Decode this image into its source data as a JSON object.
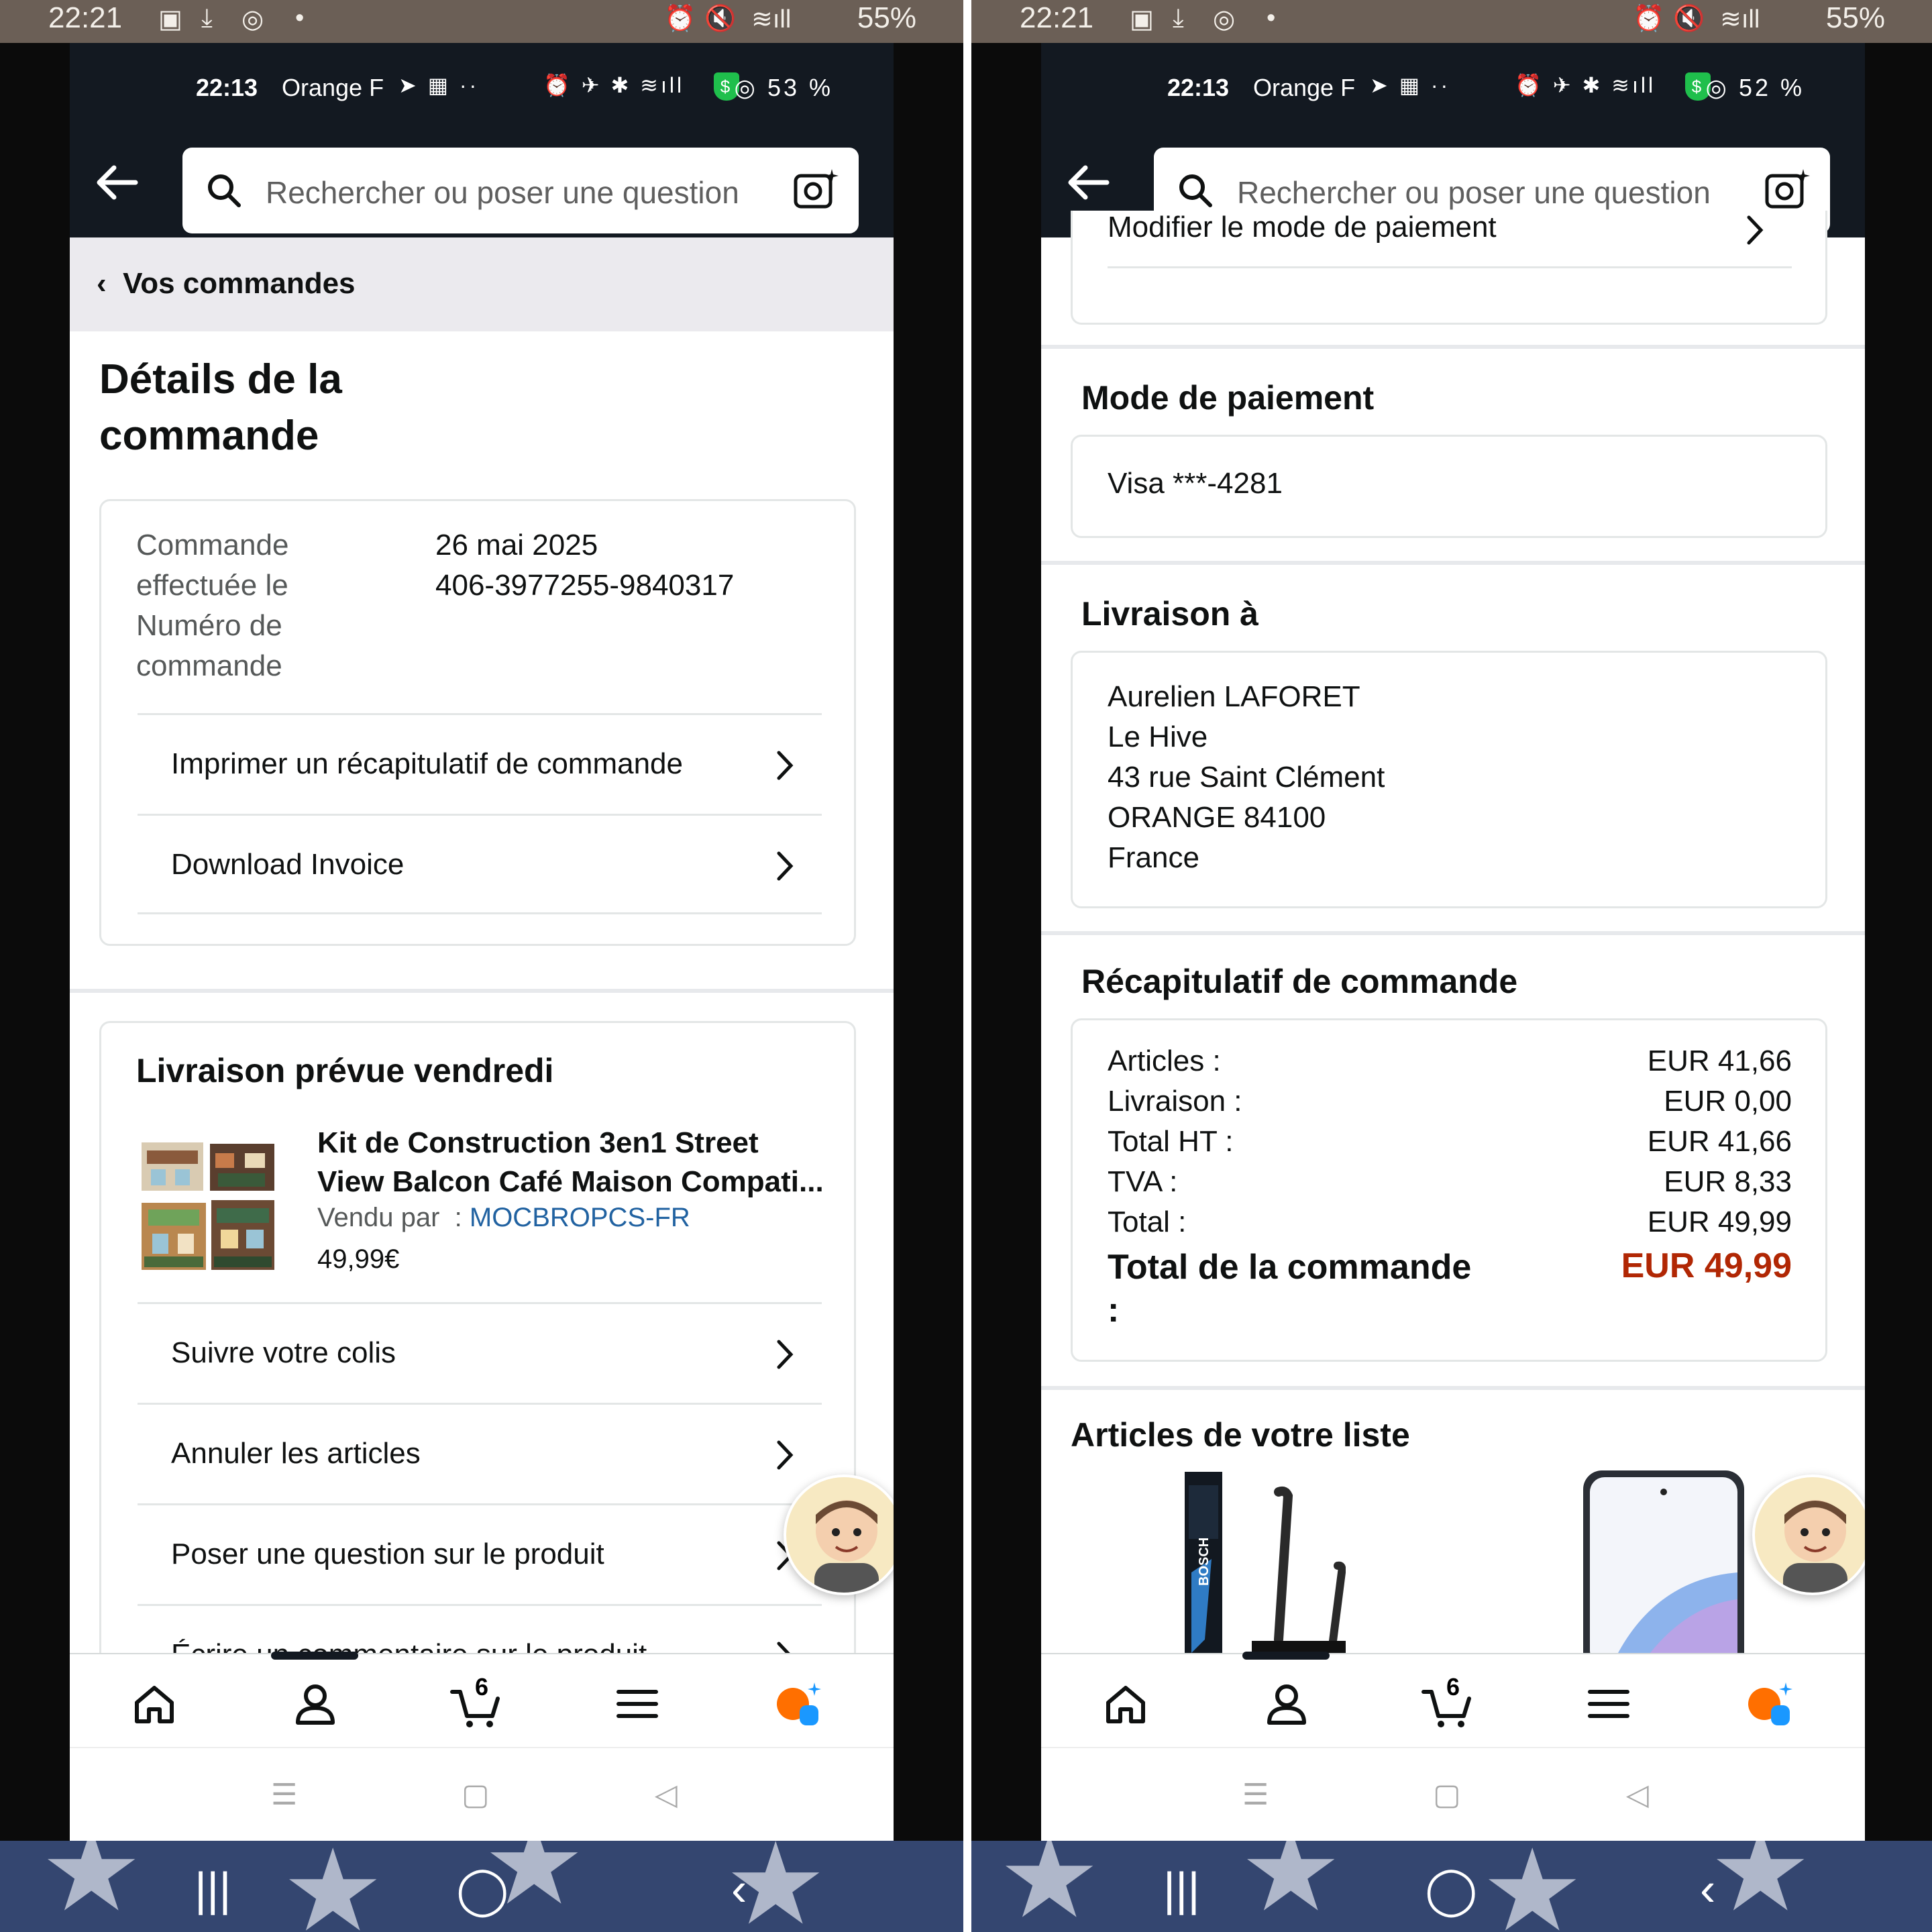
{
  "outer_status": {
    "time": "22:21",
    "battery": "55%"
  },
  "left": {
    "inner_status": {
      "time": "22:13",
      "carrier": "Orange F",
      "battery": "53 %"
    },
    "search": {
      "placeholder": "Rechercher ou poser une question"
    },
    "breadcrumb": "Vos commandes",
    "page_title": "Détails de la commande",
    "order_info": {
      "date_label": "Commande effectuée le",
      "date_value": "26 mai 2025",
      "number_label": "Numéro de commande",
      "number_value": "406-3977255-9840317"
    },
    "order_links": [
      "Imprimer un récapitulatif de commande",
      "Download Invoice"
    ],
    "delivery": {
      "heading": "Livraison prévue vendredi",
      "product_title": "Kit de Construction 3en1 Street View Balcon Café Maison Compati...",
      "seller_label": "Vendu par",
      "seller_sep": ":",
      "seller_name": "MOCBROPCS-FR",
      "price": "49,99€",
      "actions": [
        "Suivre votre colis",
        "Annuler les articles",
        "Poser une question sur le produit",
        "Écrire un commentaire sur le produit"
      ]
    },
    "nav": {
      "cart_count": "6"
    }
  },
  "right": {
    "inner_status": {
      "time": "22:13",
      "carrier": "Orange F",
      "battery": "52 %"
    },
    "search": {
      "placeholder": "Rechercher ou poser une question"
    },
    "partial_link": "Modifier le mode de paiement",
    "payment": {
      "heading": "Mode de paiement",
      "card": "Visa ***-4281"
    },
    "shipping": {
      "heading": "Livraison à",
      "lines": [
        "Aurelien LAFORET",
        "Le Hive",
        "43 rue Saint Clément",
        "ORANGE 84100",
        "France"
      ]
    },
    "summary": {
      "heading": "Récapitulatif de commande",
      "rows": [
        {
          "label": "Articles :",
          "value": "EUR 41,66"
        },
        {
          "label": "Livraison :",
          "value": "EUR 0,00"
        },
        {
          "label": "Total HT :",
          "value": "EUR 41,66"
        },
        {
          "label": "TVA :",
          "value": "EUR 8,33"
        },
        {
          "label": "Total :",
          "value": "EUR 49,99"
        }
      ],
      "total_label": "Total de la commande",
      "total_colon": ":",
      "total_value": "EUR 49,99"
    },
    "list_heading": "Articles de votre liste",
    "list_item_brand": "BOSCH",
    "nav": {
      "cart_count": "6"
    }
  },
  "colors": {
    "header": "#131921",
    "link": "#2162a1",
    "price_red": "#b12704",
    "alexa_orange": "#ff6f00",
    "alexa_blue": "#1a98ff"
  }
}
